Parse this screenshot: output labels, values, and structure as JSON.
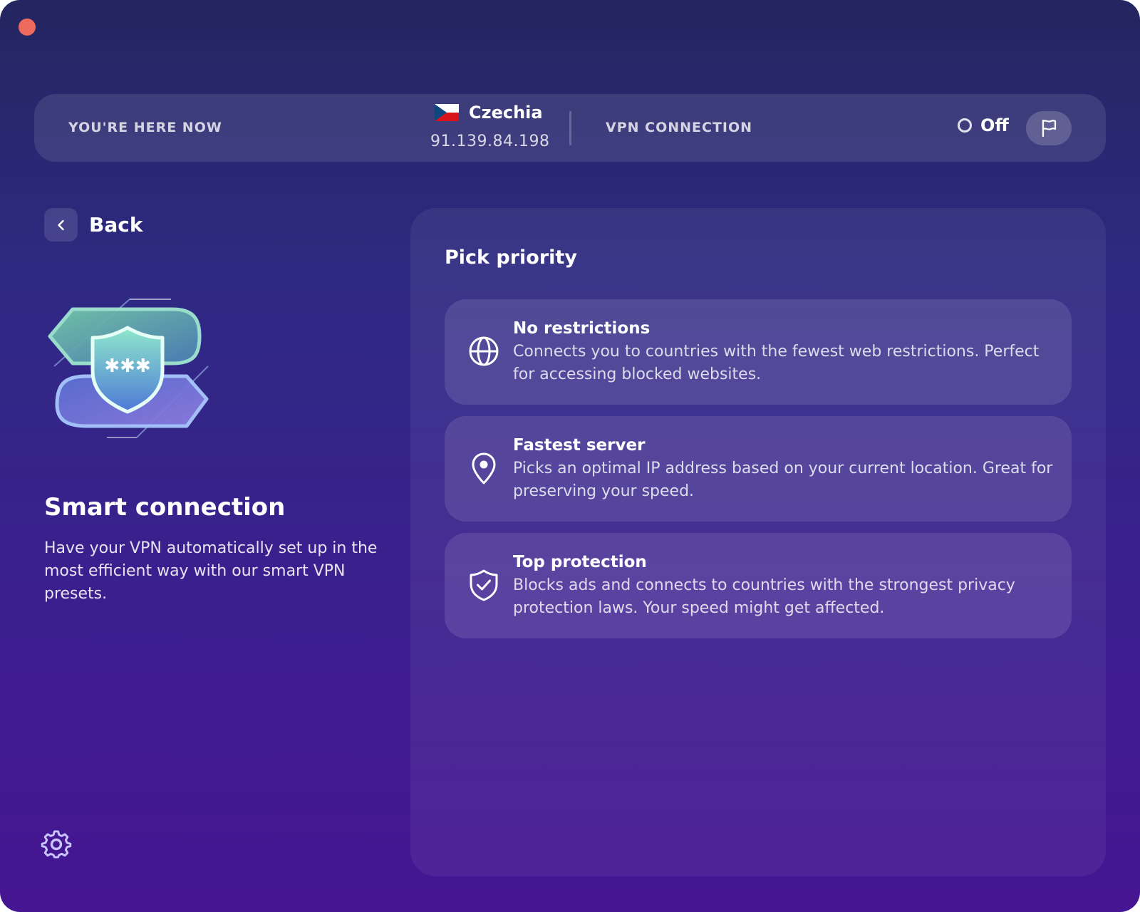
{
  "status_bar": {
    "location_label": "YOU'RE HERE NOW",
    "country": "Czechia",
    "ip": "91.139.84.198",
    "vpn_label": "VPN CONNECTION",
    "vpn_status": "Off"
  },
  "back_label": "Back",
  "feature": {
    "title": "Smart connection",
    "description": "Have your VPN automatically set up in the most efficient way with our smart VPN presets."
  },
  "panel": {
    "title": "Pick priority",
    "options": [
      {
        "icon": "globe-icon",
        "title": "No restrictions",
        "description": "Connects you to countries with the fewest web restrictions. Perfect for accessing blocked websites."
      },
      {
        "icon": "location-pin-icon",
        "title": "Fastest server",
        "description": "Picks an optimal IP address based on your current location. Great for preserving your speed."
      },
      {
        "icon": "shield-check-icon",
        "title": "Top protection",
        "description": "Blocks ads and connects to countries with the strongest privacy protection laws. Your speed might get affected."
      }
    ]
  },
  "colors": {
    "window_top": "#23265f",
    "window_bottom": "#461592",
    "close_button": "#ee6a5e",
    "shield_gradient_top": "#7de3c8",
    "shield_gradient_bottom": "#4f6fd8"
  }
}
